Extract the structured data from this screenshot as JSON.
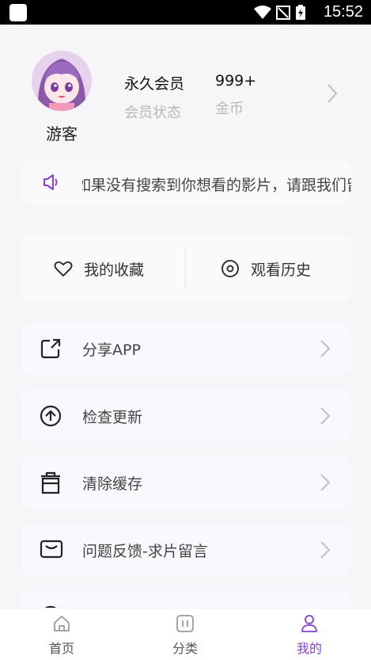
{
  "status_bar": {
    "time": "15:52"
  },
  "profile": {
    "username": "游客",
    "vip_value": "永久会员",
    "vip_label": "会员状态",
    "coin_value": "999+",
    "coin_label": "金币"
  },
  "notice": {
    "text": "如果没有搜索到你想看的影片，请跟我们留言"
  },
  "quick_links": {
    "favorites": "我的收藏",
    "history": "观看历史"
  },
  "menu": {
    "items": [
      {
        "label": "分享APP",
        "icon": "share-icon"
      },
      {
        "label": "检查更新",
        "icon": "upload-arrow-icon"
      },
      {
        "label": "清除缓存",
        "icon": "trash-icon"
      },
      {
        "label": "问题反馈-求片留言",
        "icon": "message-box-icon"
      }
    ]
  },
  "tabbar": {
    "home": "首页",
    "category": "分类",
    "mine": "我的",
    "active": "mine"
  },
  "colors": {
    "accent": "#8a3fd6",
    "background": "#f6f6f8"
  }
}
